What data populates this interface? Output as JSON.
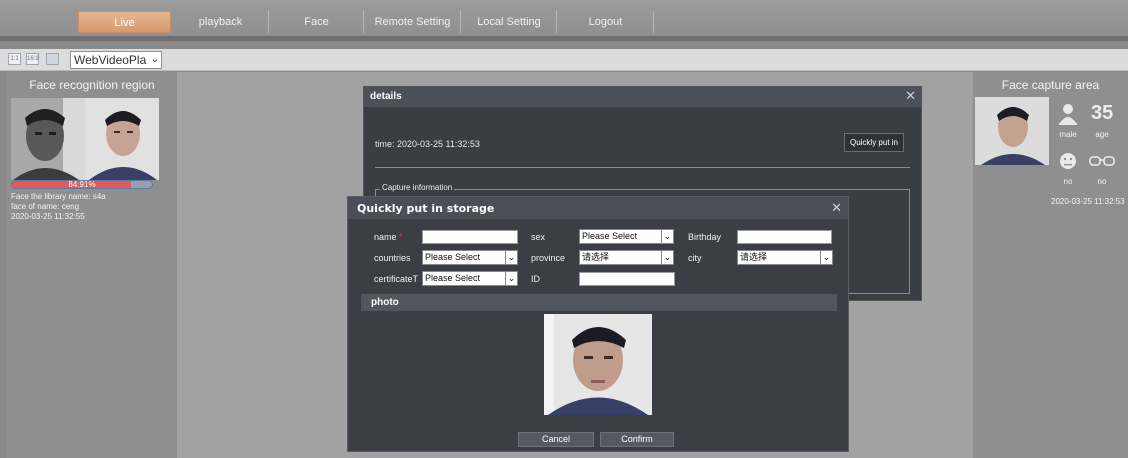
{
  "nav": {
    "tabs": [
      {
        "label": "Live",
        "active": true
      },
      {
        "label": "playback"
      },
      {
        "label": "Face"
      },
      {
        "label": "Remote Setting"
      },
      {
        "label": "Local Setting"
      },
      {
        "label": "Logout"
      }
    ]
  },
  "toolbar": {
    "icon1": "1:1",
    "icon2": "16:9",
    "player_select": "WebVideoPla"
  },
  "left": {
    "title": "Face recognition region",
    "similarity": "84.91%",
    "similarity_value": 84.91,
    "library_name": "Face the library name: s4a",
    "face_name": "face of name: ceng",
    "timestamp": "2020-03-25 11:32:55"
  },
  "right": {
    "title": "Face capture area",
    "age": "35",
    "gender": "male",
    "age_label": "age",
    "expression": "no",
    "glasses": "no",
    "timestamp": "2020-03-25 11:32:53"
  },
  "details": {
    "title": "details",
    "time": "time:  2020-03-25 11:32:53",
    "quick_button": "Quickly put in",
    "capture_legend": "Capture information"
  },
  "storage": {
    "title": "Quickly put in storage",
    "name_label": "name",
    "required_mark": "*",
    "sex_label": "sex",
    "sex_value": "Please Select",
    "birthday_label": "Birthday",
    "countries_label": "countries",
    "countries_value": "Please Select",
    "province_label": "province",
    "province_value": "请选择",
    "city_label": "city",
    "city_value": "请选择",
    "cert_label": "certificateT",
    "cert_value": "Please Select",
    "id_label": "ID",
    "photo_label": "photo",
    "cancel": "Cancel",
    "confirm": "Confirm"
  },
  "colors": {
    "active_tab": "#d9a173",
    "dialog_bg": "#3b3e45",
    "progress_fill": "#e05a5a"
  }
}
